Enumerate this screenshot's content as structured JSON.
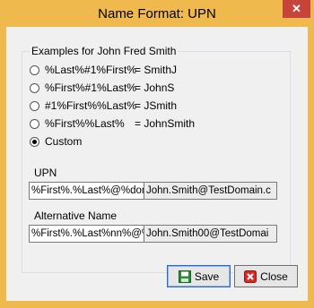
{
  "window": {
    "title": "Name Format: UPN",
    "close_glyph": "✕"
  },
  "examples": {
    "legend": "Examples for John Fred Smith",
    "options": [
      {
        "format": "%Last%#1%First%",
        "result": "= SmithJ",
        "checked": false
      },
      {
        "format": "%First%#1%Last%",
        "result": "= JohnS",
        "checked": false
      },
      {
        "format": "#1%First%%Last%",
        "result": "= JSmith",
        "checked": false
      },
      {
        "format": "%First%%Last%",
        "result": "= JohnSmith",
        "checked": false
      },
      {
        "format": "Custom",
        "result": "",
        "checked": true
      }
    ]
  },
  "upn": {
    "label": "UPN",
    "format_value": "%First%.%Last%@%domain",
    "preview_value": "John.Smith@TestDomain.c"
  },
  "alternative": {
    "label": "Alternative Name",
    "format_value": "%First%.%Last%nn%@%D",
    "preview_value": "John.Smith00@TestDomai"
  },
  "buttons": {
    "save_label": "Save",
    "close_label": "Close"
  },
  "colors": {
    "frame": "#f0b94d",
    "close_button": "#c7443b",
    "client": "#f0f0f0"
  }
}
